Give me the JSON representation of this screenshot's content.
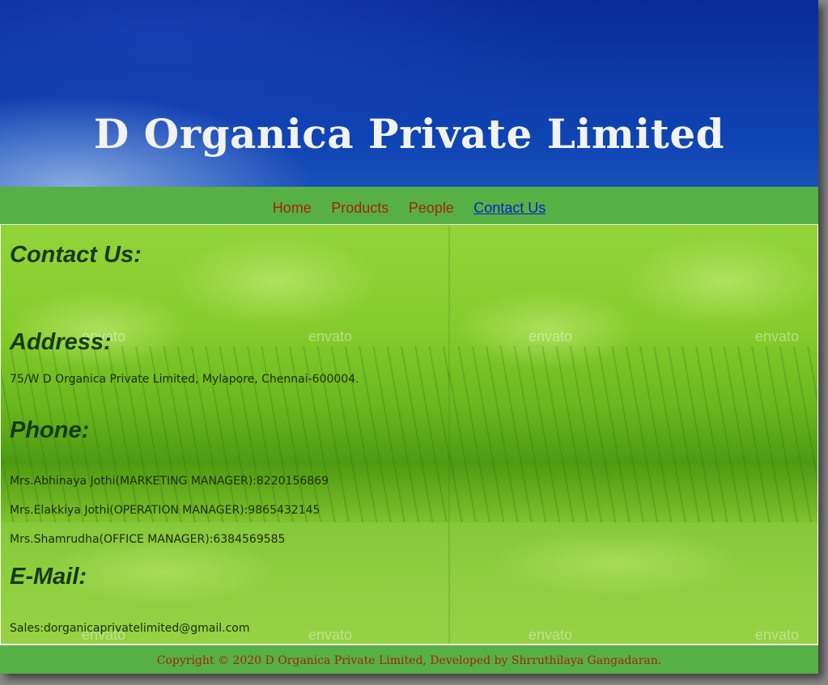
{
  "header": {
    "title": "D Organica Private Limited"
  },
  "nav": {
    "items": [
      {
        "label": "Home"
      },
      {
        "label": "Products"
      },
      {
        "label": "People"
      },
      {
        "label": "Contact Us"
      }
    ],
    "active": "Contact Us"
  },
  "main": {
    "watermark_text": "envato",
    "contact_heading": "Contact Us:",
    "address_heading": "Address:",
    "address": "75/W D Organica Private Limited, Mylapore, Chennai-600004.",
    "phone_heading": "Phone:",
    "phones": [
      "Mrs.Abhinaya Jothi(MARKETING MANAGER):8220156869",
      "Mrs.Elakkiya Jothi(OPERATION MANAGER):9865432145",
      "Mrs.Shamrudha(OFFICE MANAGER):6384569585"
    ],
    "email_heading": "E-Mail:",
    "email": "Sales:dorganicaprivatelimited@gmail.com"
  },
  "footer": {
    "copyright": "Copyright © 2020 D Organica Private Limited, Developed by Shrruthilaya Gangadaran."
  },
  "colors": {
    "header_blue": "#0e44b4",
    "nav_green": "#57b044",
    "nav_link": "#a32410",
    "nav_active": "#0b24c9",
    "heading_text": "#163a12"
  }
}
